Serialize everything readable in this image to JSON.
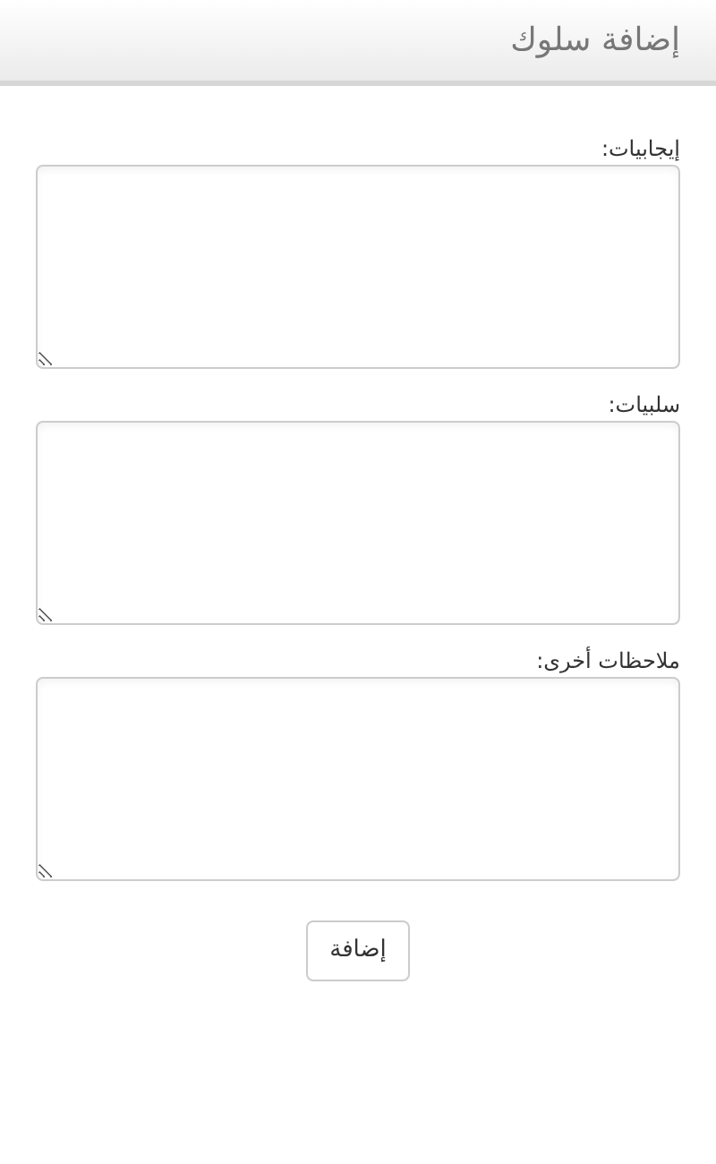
{
  "header": {
    "title": "إضافة سلوك"
  },
  "fields": [
    {
      "label": "إيجابيات:"
    },
    {
      "label": "سلبيات:"
    },
    {
      "label": "ملاحظات أخرى:"
    }
  ],
  "submit_button": {
    "label": "إضافة"
  }
}
